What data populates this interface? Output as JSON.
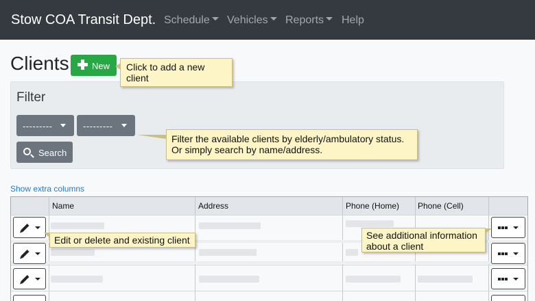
{
  "navbar": {
    "brand": "Stow COA Transit Dept.",
    "items": [
      {
        "label": "Schedule",
        "dropdown": true
      },
      {
        "label": "Vehicles",
        "dropdown": true
      },
      {
        "label": "Reports",
        "dropdown": true
      },
      {
        "label": "Help",
        "dropdown": false
      }
    ]
  },
  "page": {
    "title": "Clients",
    "new_button": "New"
  },
  "filter": {
    "title": "Filter",
    "elderly_select": "---------",
    "ambulatory_select": "---------",
    "search_button": "Search"
  },
  "extra_columns_link": "Show extra columns",
  "table": {
    "columns": [
      "Name",
      "Address",
      "Phone (Home)",
      "Phone (Cell)"
    ]
  },
  "callouts": {
    "new": "Click to add a new client",
    "filter_line1": "Filter the available clients by elderly/ambulatory status.",
    "filter_line2": "Or simply search by name/address.",
    "edit": "Edit or delete and existing client",
    "info_line1": "See additional information",
    "info_line2": "about a client"
  },
  "colors": {
    "navbar": "#343a40",
    "new_button": "#28a745",
    "filter_buttons": "#6c757d",
    "link": "#1c7cd5",
    "callout": "#fdf5c6"
  },
  "icons": [
    "plus-icon",
    "search-icon",
    "pencil-icon",
    "ellipsis-icon",
    "caret-down-icon"
  ]
}
